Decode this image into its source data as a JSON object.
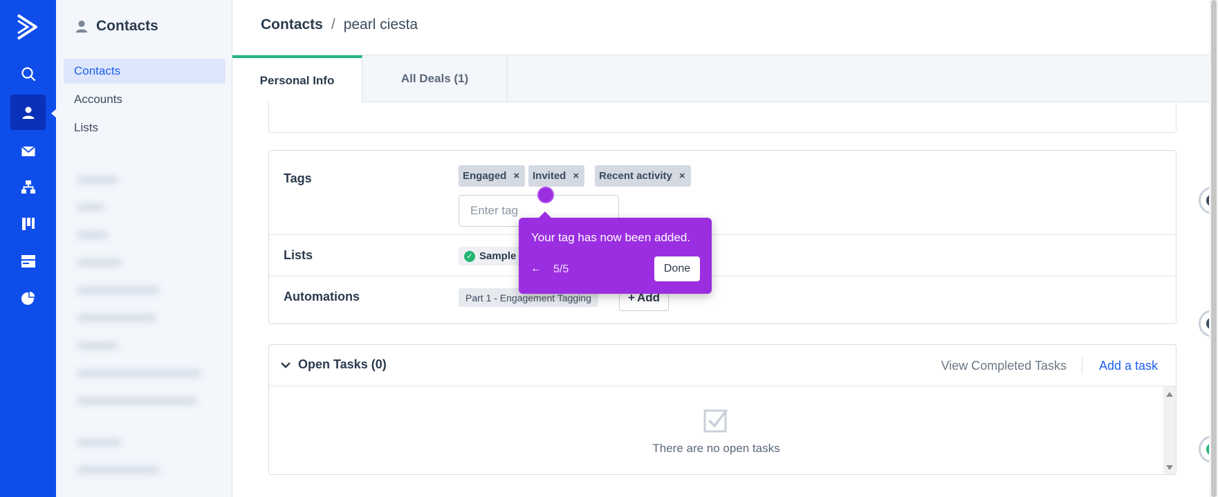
{
  "subnav": {
    "title": "Contacts",
    "items": [
      {
        "label": "Contacts"
      },
      {
        "label": "Accounts"
      },
      {
        "label": "Lists"
      }
    ]
  },
  "breadcrumb": {
    "section": "Contacts",
    "separator": "/",
    "contact_name": "pearl ciesta"
  },
  "tabs": [
    {
      "label": "Personal Info"
    },
    {
      "label": "All Deals (1)"
    }
  ],
  "info": {
    "tags_label": "Tags",
    "tags": [
      {
        "label": "Engaged",
        "remove": "×"
      },
      {
        "label": "Invited",
        "remove": "×"
      },
      {
        "label": "Recent activity",
        "remove": "×"
      }
    ],
    "tag_placeholder": "Enter tag",
    "lists_label": "Lists",
    "list_chip": "Sample",
    "automations_label": "Automations",
    "automation_chip": "Part 1 - Engagement Tagging",
    "add_label": "Add"
  },
  "tasks": {
    "title": "Open Tasks (0)",
    "view_completed": "View Completed Tasks",
    "add_task": "Add a task",
    "empty_text": "There are no open tasks"
  },
  "tooltip": {
    "message": "Your tag has now been added.",
    "back": "←",
    "step": "5/5",
    "done": "Done"
  },
  "colors": {
    "rail": "#0f4dea",
    "accent_blue": "#1d5ff0",
    "tab_active_border": "#23b48a",
    "tooltip": "#9b2ee0"
  },
  "icons": {
    "rail": [
      "logo-icon",
      "search-icon",
      "contacts-icon",
      "email-icon",
      "automation-icon",
      "deals-icon",
      "site-icon",
      "reports-icon"
    ]
  }
}
